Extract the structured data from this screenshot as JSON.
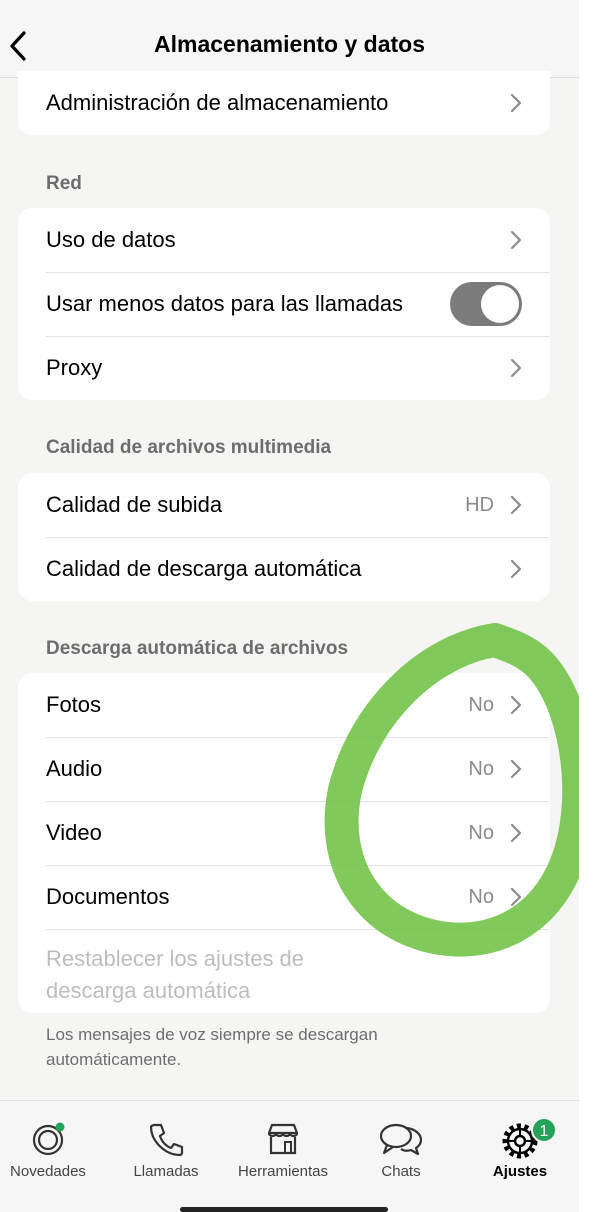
{
  "header": {
    "title": "Almacenamiento y datos"
  },
  "storage": {
    "manage_label": "Administración de almacenamiento"
  },
  "network": {
    "heading": "Red",
    "data_usage": "Uso de datos",
    "less_data_calls": "Usar menos datos para las llamadas",
    "less_data_calls_on": true,
    "proxy": "Proxy"
  },
  "media_quality": {
    "heading": "Calidad de archivos multimedia",
    "upload_label": "Calidad de subida",
    "upload_value": "HD",
    "auto_download_quality": "Calidad de descarga automática"
  },
  "auto_download": {
    "heading": "Descarga automática de archivos",
    "items": [
      {
        "label": "Fotos",
        "value": "No"
      },
      {
        "label": "Audio",
        "value": "No"
      },
      {
        "label": "Video",
        "value": "No"
      },
      {
        "label": "Documentos",
        "value": "No"
      }
    ],
    "reset_line1": "Restablecer los ajustes de",
    "reset_line2": "descarga automática",
    "footnote": "Los mensajes de voz siempre se descargan automáticamente."
  },
  "tabs": [
    {
      "label": "Novedades",
      "icon": "updates-icon"
    },
    {
      "label": "Llamadas",
      "icon": "phone-icon"
    },
    {
      "label": "Herramientas",
      "icon": "storefront-icon"
    },
    {
      "label": "Chats",
      "icon": "chat-bubbles-icon"
    },
    {
      "label": "Ajustes",
      "icon": "gear-icon",
      "badge": "1",
      "active": true
    }
  ],
  "colors": {
    "badge": "#25a35a",
    "annotation": "#6cbf3f",
    "toggle": "#7b7b7b"
  }
}
